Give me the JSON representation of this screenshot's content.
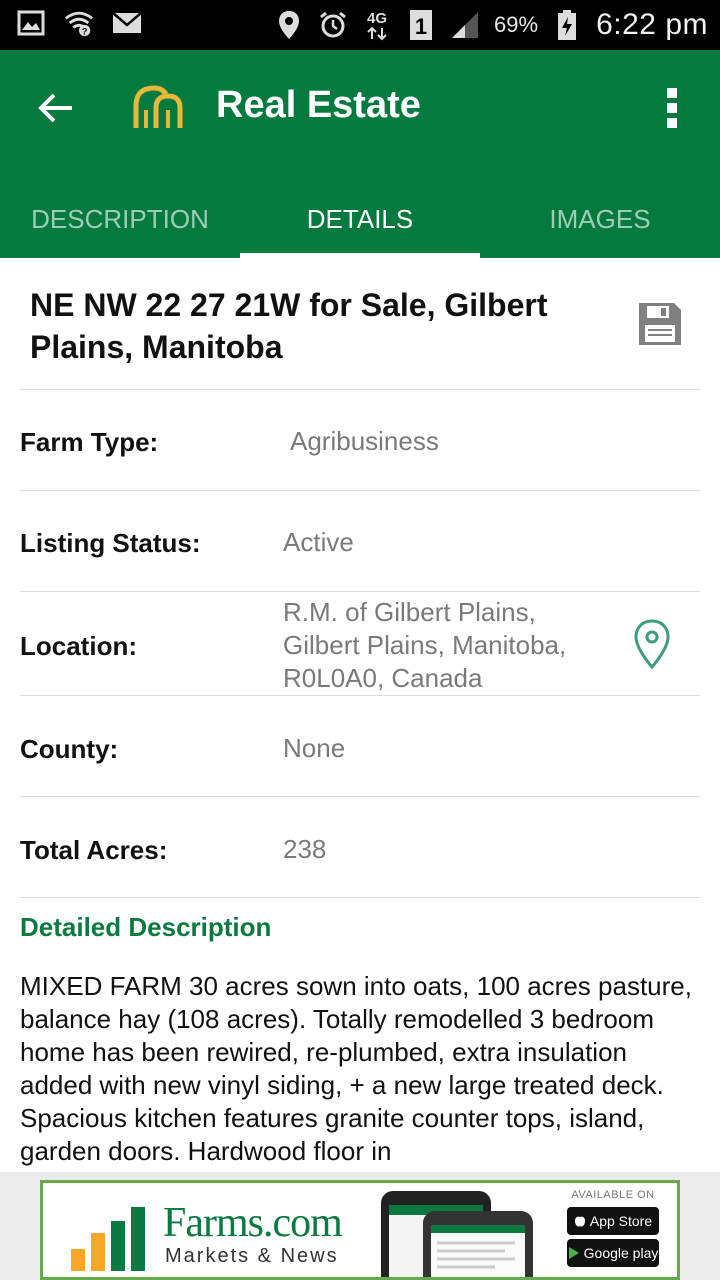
{
  "status_bar": {
    "icons_left": [
      "gallery-icon",
      "wifi-question-icon",
      "mail-icon"
    ],
    "icons_right": [
      "location-icon",
      "alarm-icon",
      "network-4g-icon",
      "sim-1-icon",
      "signal-icon"
    ],
    "battery": "69%",
    "time": "6:22 pm"
  },
  "app_bar": {
    "title": "Real Estate",
    "back_icon": "arrow-left-icon",
    "menu_icon": "overflow-menu-icon",
    "color": "#047a3f"
  },
  "tabs": [
    {
      "label": "DESCRIPTION",
      "active": false
    },
    {
      "label": "DETAILS",
      "active": true
    },
    {
      "label": "IMAGES",
      "active": false
    }
  ],
  "listing": {
    "title": "NE NW 22 27 21W for Sale, Gilbert Plains, Manitoba",
    "save_icon": "floppy-disk-icon"
  },
  "details": [
    {
      "label": "Farm Type:",
      "value": "Agribusiness"
    },
    {
      "label": "Listing Status:",
      "value": "Active"
    },
    {
      "label": "Location:",
      "value": "R.M. of Gilbert Plains, Gilbert Plains, Manitoba, R0L0A0, Canada"
    },
    {
      "label": "County:",
      "value": "None"
    },
    {
      "label": "Total Acres:",
      "value": "238"
    }
  ],
  "description": {
    "heading": "Detailed Description",
    "text": "MIXED FARM 30 acres sown into oats, 100 acres pasture, balance hay (108 acres). Totally remodelled 3 bedroom home has been rewired, re-plumbed, extra insulation added with new vinyl siding, + a new large treated deck. Spacious kitchen features granite counter tops, island, garden doors. Hardwood floor in"
  },
  "ad": {
    "brand": "Farms.com",
    "tagline": "Markets & News",
    "available_on": "AVAILABLE ON",
    "app_store": "App Store",
    "google_play": "Google play"
  }
}
